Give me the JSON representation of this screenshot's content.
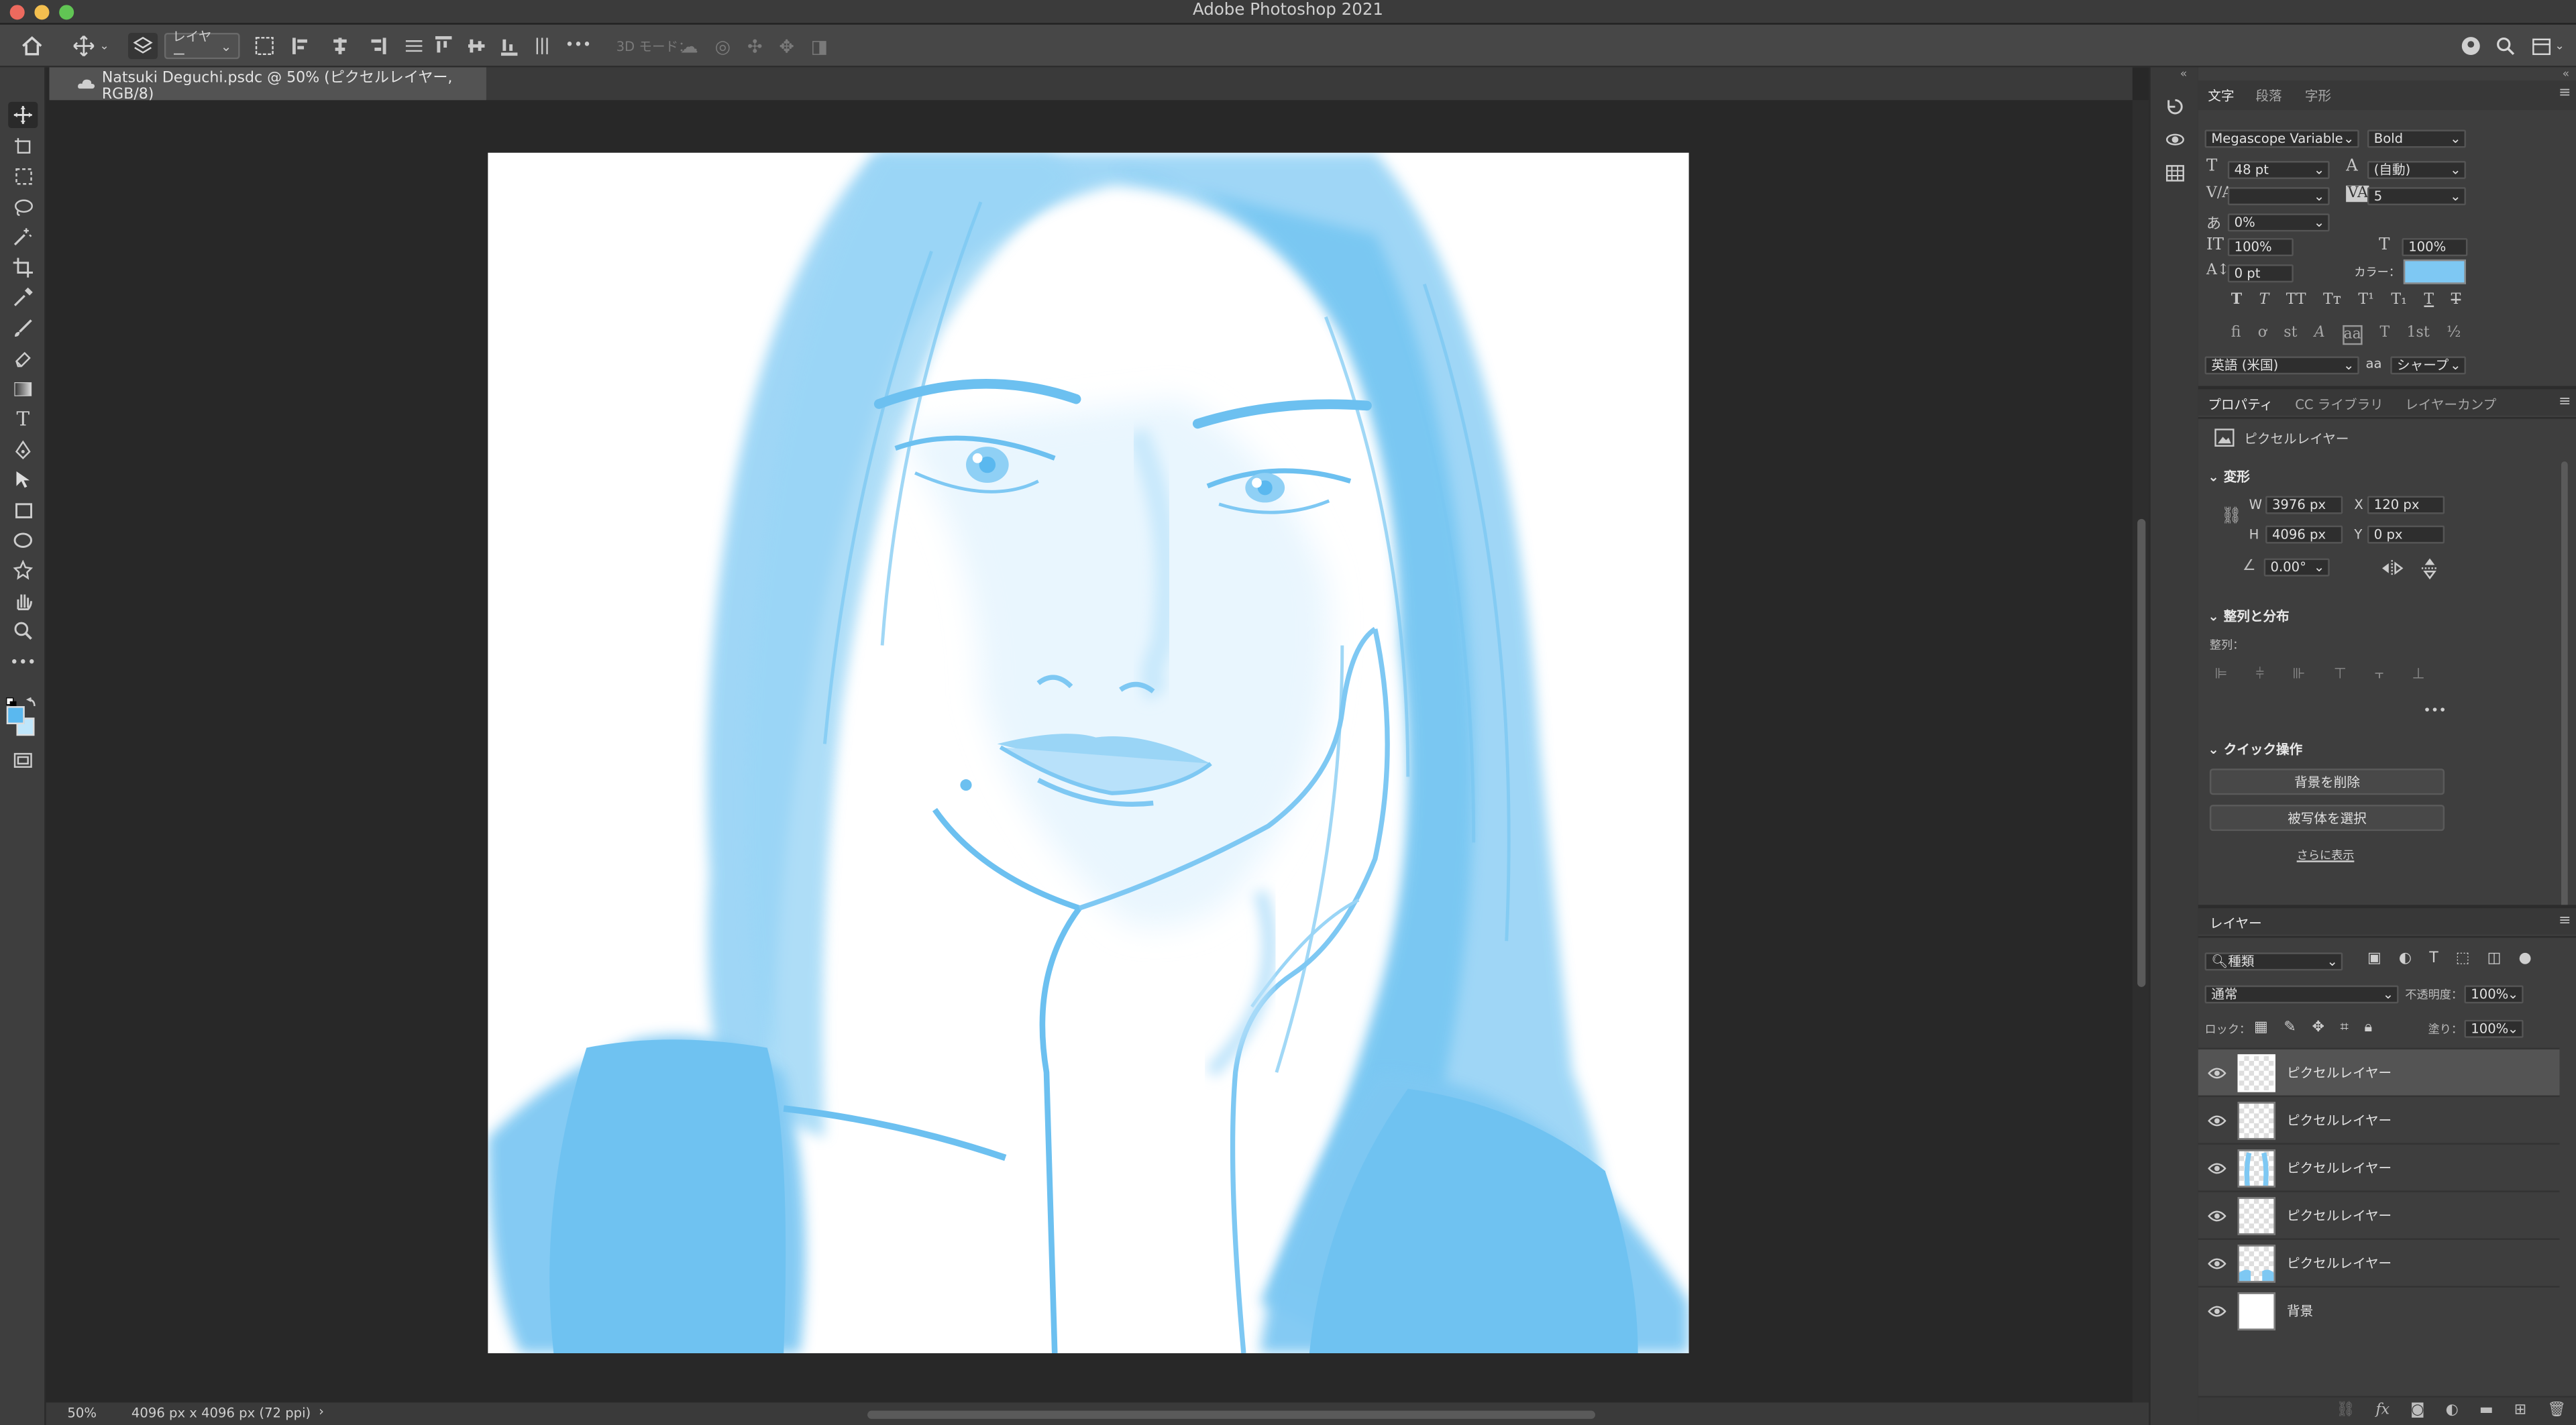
{
  "window": {
    "title": "Adobe Photoshop 2021"
  },
  "options_bar": {
    "layer_select": "レイヤー",
    "mode_3d": "3D モード：",
    "more": "•••"
  },
  "document": {
    "tab_title": "Natsuki Deguchi.psdc @ 50% (ピクセルレイヤー, RGB/8)"
  },
  "status": {
    "zoom": "50%",
    "doc_size": "4096 px x 4096 px (72 ppi)",
    "arrow": "›"
  },
  "colors": {
    "accent": "#7ec8f3",
    "foreground": "#5ab8ef",
    "background": "#bfe6fb"
  },
  "character_panel": {
    "tabs": [
      "文字",
      "段落",
      "字形"
    ],
    "font_family": "Megascope Variable",
    "font_style": "Bold",
    "font_size": "48 pt",
    "leading": "(自動)",
    "kerning": "",
    "tracking": "5",
    "tsume": "0%",
    "vertical_scale": "100%",
    "horizontal_scale": "100%",
    "baseline_shift": "0 pt",
    "color_label": "カラー：",
    "language": "英語 (米国)",
    "antialias_icon": "aa",
    "antialias": "シャープ",
    "style_glyphs": [
      "T",
      "T",
      "TT",
      "Tт",
      "T¹",
      "T₁",
      "T",
      "T"
    ],
    "opentype_glyphs": [
      "fi",
      "ơ",
      "st",
      "A",
      "aa",
      "T",
      "1st",
      "½"
    ]
  },
  "properties_panel": {
    "tabs": [
      "プロパティ",
      "CC ライブラリ",
      "レイヤーカンプ"
    ],
    "layer_type": "ピクセルレイヤー",
    "transform_section": "変形",
    "w_label": "W",
    "w": "3976 px",
    "x_label": "X",
    "x": "120 px",
    "h_label": "H",
    "h": "4096 px",
    "y_label": "Y",
    "y": "0 px",
    "angle": "0.00°",
    "align_section": "整列と分布",
    "align_label": "整列：",
    "more_dots": "•••",
    "quick_section": "クイック操作",
    "remove_bg": "背景を削除",
    "select_subject": "被写体を選択",
    "show_more": "さらに表示"
  },
  "layers_panel": {
    "tab": "レイヤー",
    "filter": "種類",
    "blend_mode": "通常",
    "opacity_label": "不透明度：",
    "opacity": "100%",
    "lock_label": "ロック：",
    "fill_label": "塗り：",
    "fill": "100%",
    "layers": [
      {
        "name": "ピクセルレイヤー",
        "selected": true
      },
      {
        "name": "ピクセルレイヤー",
        "selected": false
      },
      {
        "name": "ピクセルレイヤー",
        "selected": false
      },
      {
        "name": "ピクセルレイヤー",
        "selected": false
      },
      {
        "name": "ピクセルレイヤー",
        "selected": false
      },
      {
        "name": "背景",
        "selected": false
      }
    ]
  }
}
